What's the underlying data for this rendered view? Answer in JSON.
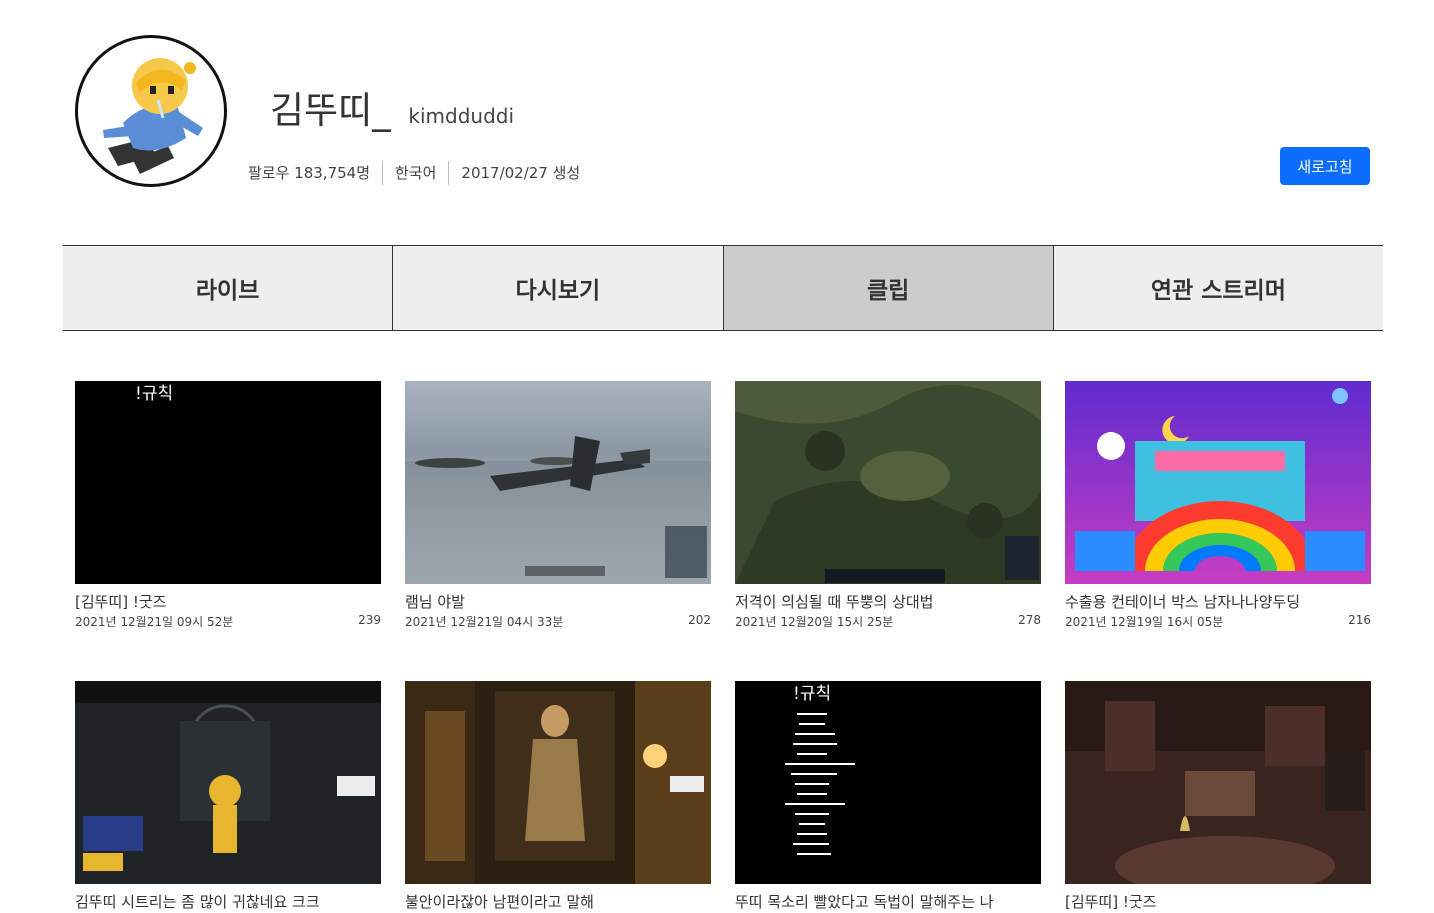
{
  "channel": {
    "display_name": "김뚜띠_",
    "login": "kimdduddi",
    "followers": "팔로우 183,754명",
    "language": "한국어",
    "created": "2017/02/27 생성",
    "refresh_label": "새로고침",
    "accent_color": "#0d6efd"
  },
  "tabs": [
    {
      "label": "라이브"
    },
    {
      "label": "다시보기"
    },
    {
      "label": "클립",
      "active": true
    },
    {
      "label": "연관 스트리머"
    }
  ],
  "clips": [
    {
      "title": "[김뚜띠] !굿즈",
      "date": "2021년 12월21일 09시 52분",
      "views": "239",
      "thumb_text": "!규칙"
    },
    {
      "title": "램님 야발",
      "date": "2021년 12월21일 04시 33분",
      "views": "202"
    },
    {
      "title": "저격이 의심될 때 뚜뿡의 상대법",
      "date": "2021년 12월20일 15시 25분",
      "views": "278"
    },
    {
      "title": "수출용 컨테이너 박스 남자나나양두딩",
      "date": "2021년 12월19일 16시 05분",
      "views": "216"
    },
    {
      "title": "김뚜띠 시트리는 좀 많이 귀찮네요 크크",
      "date": "",
      "views": ""
    },
    {
      "title": "불안이라잖아 남편이라고 말해",
      "date": "",
      "views": ""
    },
    {
      "title": "뚜띠 목소리 빨았다고 독법이 말해주는 나",
      "date": "",
      "views": "",
      "thumb_text": "!규칙"
    },
    {
      "title": "[김뚜띠] !굿즈",
      "date": "",
      "views": ""
    }
  ]
}
